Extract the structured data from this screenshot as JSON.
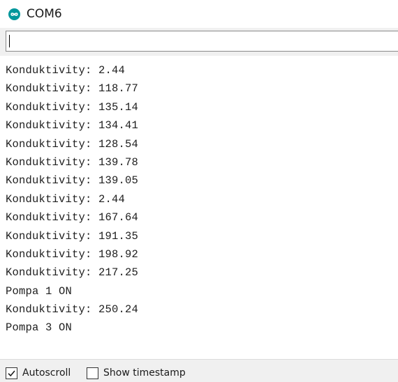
{
  "window": {
    "title": "COM6",
    "icon": "arduino-infinity-icon",
    "accent": "#00979C"
  },
  "send": {
    "value": ""
  },
  "output": {
    "lines": [
      "Konduktivity: 2.44",
      "Konduktivity: 118.77",
      "Konduktivity: 135.14",
      "Konduktivity: 134.41",
      "Konduktivity: 128.54",
      "Konduktivity: 139.78",
      "Konduktivity: 139.05",
      "Konduktivity: 2.44",
      "Konduktivity: 167.64",
      "Konduktivity: 191.35",
      "Konduktivity: 198.92",
      "Konduktivity: 217.25",
      "Pompa 1 ON",
      "Konduktivity: 250.24",
      "Pompa 3 ON"
    ]
  },
  "footer": {
    "autoscroll_label": "Autoscroll",
    "autoscroll_checked": true,
    "timestamp_label": "Show timestamp",
    "timestamp_checked": false
  }
}
